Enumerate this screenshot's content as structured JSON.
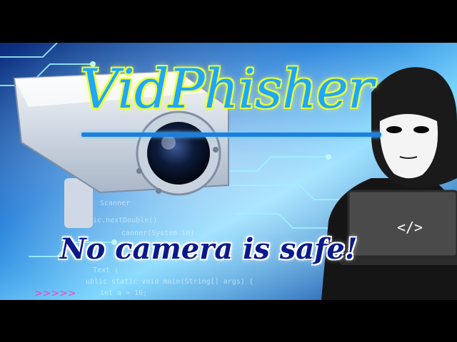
{
  "title": "VidPhisher",
  "tagline": "No camera is safe!",
  "laptop_code_glyph": "</>",
  "colors": {
    "title_fill": "#1fa6ff",
    "title_outline": "#e4ff3a",
    "tagline_fill": "#0a1a8a",
    "tagline_outline": "#ffffff",
    "background_glow": "#29b6ff",
    "accent_pink": "#ff40c0"
  },
  "icons": [
    "cctv-camera-icon",
    "hacker-figure-icon",
    "laptop-icon"
  ]
}
